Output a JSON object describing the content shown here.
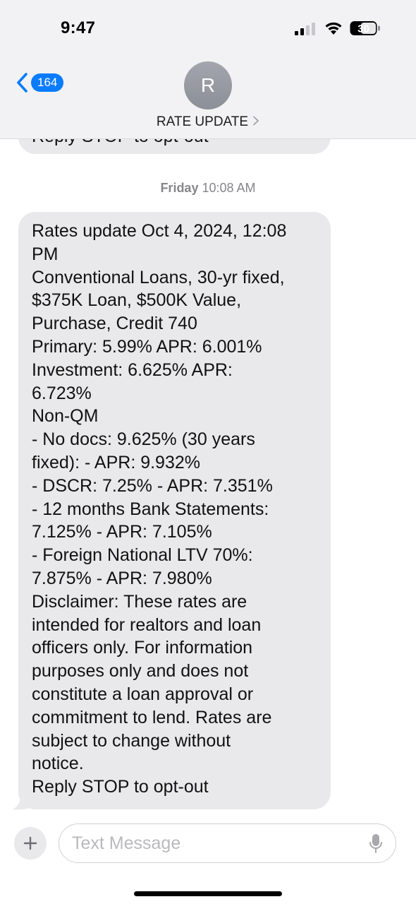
{
  "status_bar": {
    "time": "9:47",
    "battery_level": "30"
  },
  "header": {
    "back_count": "164",
    "avatar_initial": "R",
    "contact_name": "RATE UPDATE"
  },
  "previous_message": {
    "visible_text": "Reply STOP to opt-out"
  },
  "timestamp": {
    "day": "Friday",
    "time": "10:08 AM"
  },
  "message": {
    "lines": [
      "Rates update Oct 4, 2024, 12:08",
      "PM",
      "Conventional Loans, 30-yr fixed,",
      "$375K Loan, $500K Value,",
      "Purchase, Credit 740",
      "Primary: 5.99% APR: 6.001%",
      "Investment: 6.625% APR:",
      "6.723%",
      "Non-QM",
      "- No docs: 9.625% (30 years",
      "fixed): - APR: 9.932%",
      "- DSCR: 7.25% - APR: 7.351%",
      "- 12 months Bank Statements:",
      "7.125% - APR: 7.105%",
      "- Foreign National LTV 70%:",
      "7.875% - APR: 7.980%",
      "Disclaimer: These rates are",
      "intended for realtors and loan",
      "officers only. For information",
      "purposes only and does not",
      "constitute a loan approval or",
      "commitment to lend. Rates are",
      "subject to change without",
      "notice.",
      "Reply STOP to opt-out"
    ]
  },
  "composer": {
    "placeholder": "Text Message"
  },
  "colors": {
    "bubble": "#e9e9eb",
    "accent": "#0a7cff",
    "header_bg": "#f2f2f4"
  },
  "icons": [
    "back-chevron-icon",
    "signal-icon",
    "wifi-icon",
    "battery-icon",
    "chevron-right-icon",
    "plus-icon",
    "mic-icon"
  ]
}
